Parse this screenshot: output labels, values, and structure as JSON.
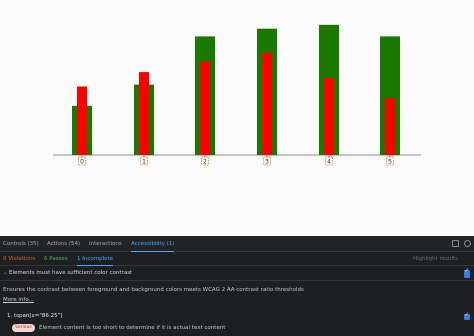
{
  "chart_data": {
    "type": "bar",
    "categories": [
      "0",
      "1",
      "2",
      "3",
      "4",
      "5"
    ],
    "series": [
      {
        "color": "#1a7a00",
        "values": [
          51,
          73,
          123,
          131,
          135,
          123
        ]
      },
      {
        "color": "#ff0000",
        "values": [
          71,
          86,
          97,
          106,
          80,
          59
        ]
      }
    ],
    "ylim": [
      0,
      140
    ],
    "grid": false,
    "legend": "none"
  },
  "panel": {
    "tabs": [
      "Controls (35)",
      "Actions (54)",
      "Interactions",
      "Accessibility (1)"
    ],
    "active_tab": "Accessibility (1)",
    "icons": [
      "external-link-icon",
      "settings-icon"
    ],
    "subtabs": {
      "violations": "0 Violations",
      "passes": "6 Passes",
      "incomplete": "1 Incomplete"
    },
    "highlight_label": "Highlight results",
    "highlight_checked": true,
    "rule": {
      "title": "Elements must have sufficient color contrast",
      "checked": true,
      "description": "Ensures the contrast between foreground and background colors meets WCAG 2 AA contrast ratio thresholds",
      "more_info": "More info..."
    },
    "node": {
      "label": "1. tspan[x=\"86.25\"]",
      "checked": true,
      "badge": "Serious",
      "message": "Element content is too short to determine if it is actual text content"
    },
    "colors": {
      "accent": "#4ea2ff",
      "violations": "#e15e2f",
      "passes": "#3fbf5a",
      "tick_outline": "#e08a2b"
    }
  }
}
